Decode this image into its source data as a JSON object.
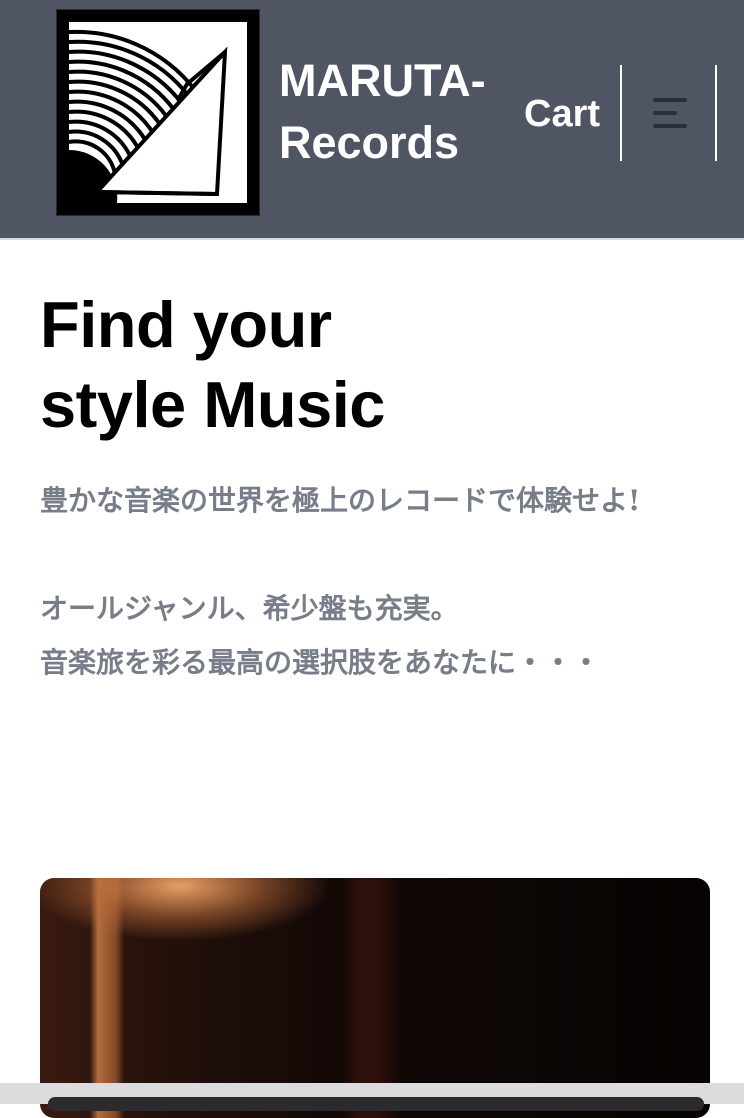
{
  "header": {
    "logo_icon": "record-vinyl-logo-icon",
    "brand_lines": [
      "MARUTA-",
      "Records"
    ],
    "cart_label": "Cart",
    "menu_icon": "hamburger-menu-icon",
    "background_color": "#4f5563"
  },
  "hero": {
    "title_lines": [
      "Find your",
      "style Music"
    ],
    "paragraph_1": "豊かな音楽の世界を極上のレコードで体験せよ!",
    "paragraph_2_lines": [
      "オールジャンル、希少盤も充実。",
      "音楽旅を彩る最高の選択肢をあなたに・・・"
    ],
    "text_color": "#777e8a"
  },
  "hero_image": {
    "icon": "lamp-photo-image"
  }
}
